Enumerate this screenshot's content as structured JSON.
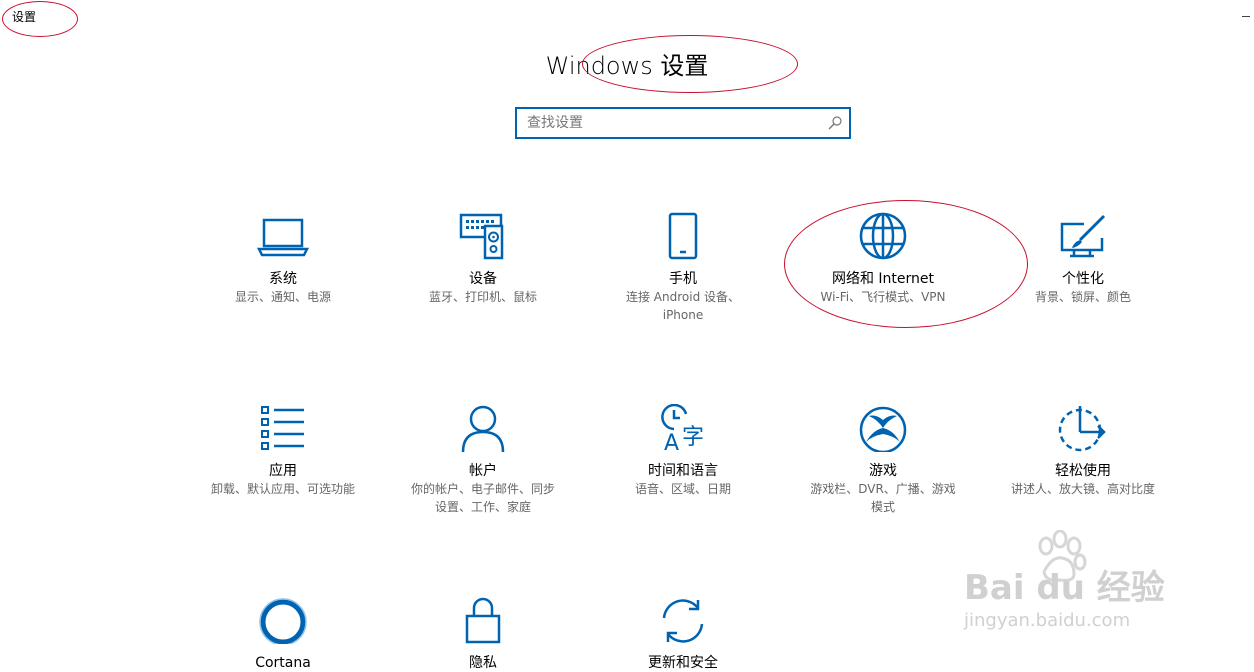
{
  "window": {
    "title": "设置"
  },
  "header": {
    "title": "Windows 设置"
  },
  "search": {
    "placeholder": "查找设置",
    "icon": "search-icon"
  },
  "accent_color": "#0063b1",
  "annotation_color": "#c8102e",
  "tiles": [
    {
      "name": "系统",
      "desc": [
        "显示、通知、电源"
      ],
      "icon": "laptop-icon"
    },
    {
      "name": "设备",
      "desc": [
        "蓝牙、打印机、鼠标"
      ],
      "icon": "keyboard-speaker-icon"
    },
    {
      "name": "手机",
      "desc": [
        "连接 Android 设备、",
        "iPhone"
      ],
      "icon": "phone-icon"
    },
    {
      "name": "网络和 Internet",
      "desc": [
        "Wi-Fi、飞行模式、VPN"
      ],
      "icon": "globe-icon"
    },
    {
      "name": "个性化",
      "desc": [
        "背景、锁屏、颜色"
      ],
      "icon": "paint-icon"
    },
    {
      "name": "应用",
      "desc": [
        "卸载、默认应用、可选功能"
      ],
      "icon": "apps-list-icon"
    },
    {
      "name": "帐户",
      "desc": [
        "你的帐户、电子邮件、同步",
        "设置、工作、家庭"
      ],
      "icon": "person-icon"
    },
    {
      "name": "时间和语言",
      "desc": [
        "语音、区域、日期"
      ],
      "icon": "time-language-icon"
    },
    {
      "name": "游戏",
      "desc": [
        "游戏栏、DVR、广播、游戏",
        "模式"
      ],
      "icon": "xbox-icon"
    },
    {
      "name": "轻松使用",
      "desc": [
        "讲述人、放大镜、高对比度"
      ],
      "icon": "ease-of-access-icon"
    },
    {
      "name": "Cortana",
      "desc": [],
      "icon": "cortana-icon"
    },
    {
      "name": "隐私",
      "desc": [],
      "icon": "lock-icon"
    },
    {
      "name": "更新和安全",
      "desc": [],
      "icon": "sync-icon"
    }
  ],
  "watermark": {
    "logo": "Bai du 经验",
    "url": "jingyan.baidu.com"
  }
}
